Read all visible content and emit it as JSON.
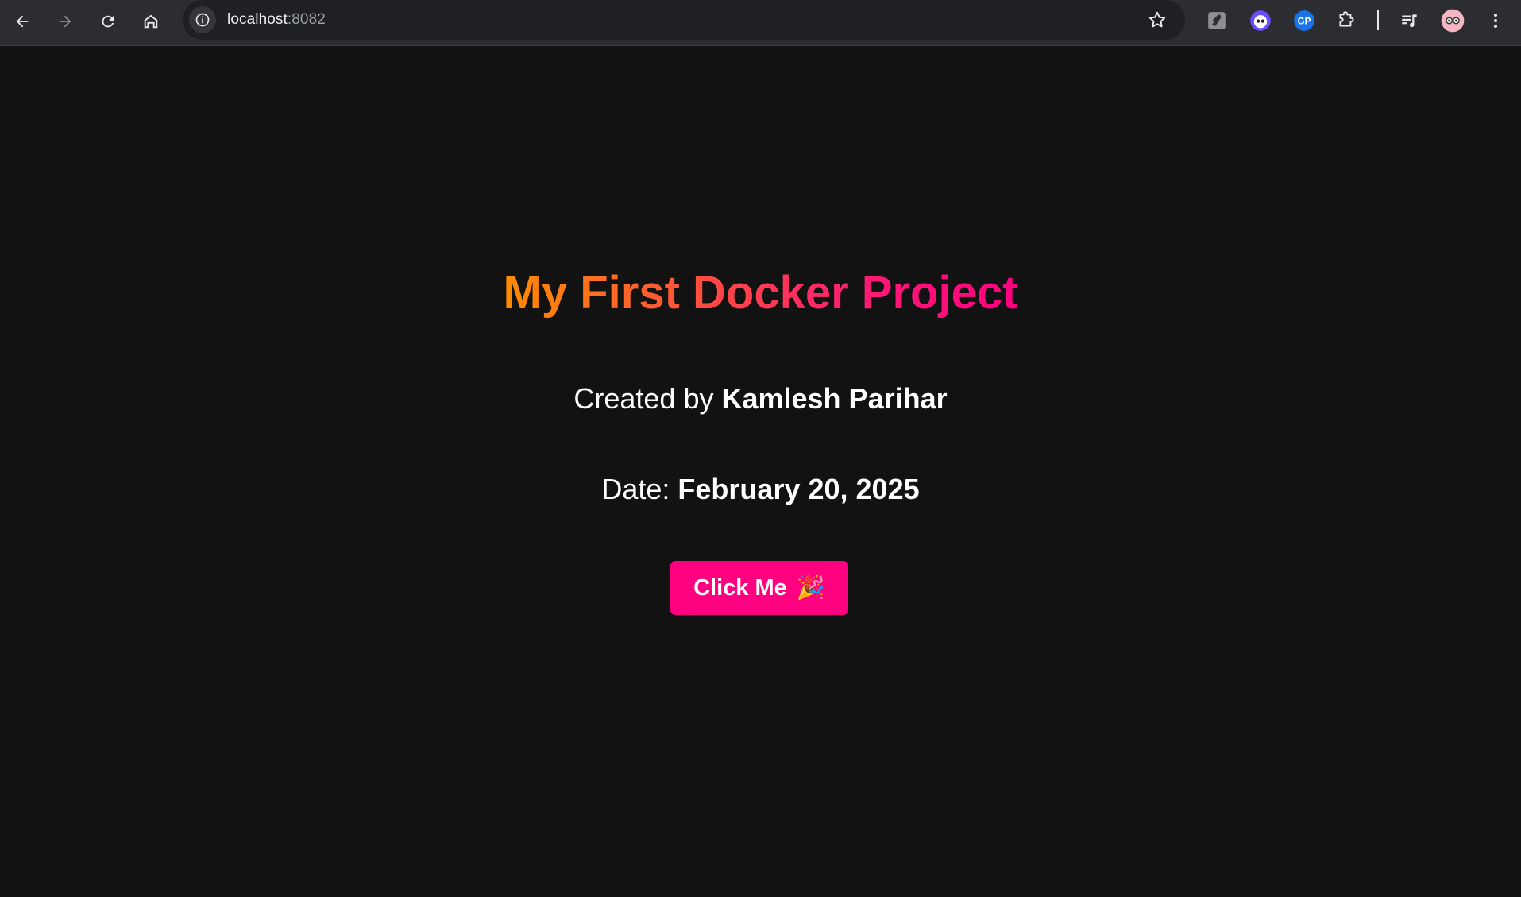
{
  "browser": {
    "url_host": "localhost",
    "url_port": ":8082",
    "icons": [
      "back-icon",
      "forward-icon",
      "reload-icon",
      "home-icon",
      "site-info-icon",
      "bookmark-star-icon",
      "extension-1-icon",
      "extension-2-icon",
      "extension-3-icon",
      "extensions-puzzle-icon",
      "media-control-icon",
      "profile-avatar-icon",
      "menu-kebab-icon"
    ]
  },
  "page": {
    "title": "My First Docker Project",
    "creator_prefix": "Created by ",
    "creator_name": "Kamlesh Parihar",
    "date_prefix": "Date: ",
    "date_value": "February 20, 2025",
    "button_label": "Click Me",
    "button_emoji": "🎉"
  },
  "colors": {
    "background": "#121212",
    "title_gradient_start": "#ff8c00",
    "title_gradient_end": "#ff0080",
    "button": "#ff0080",
    "text": "#ffffff"
  }
}
